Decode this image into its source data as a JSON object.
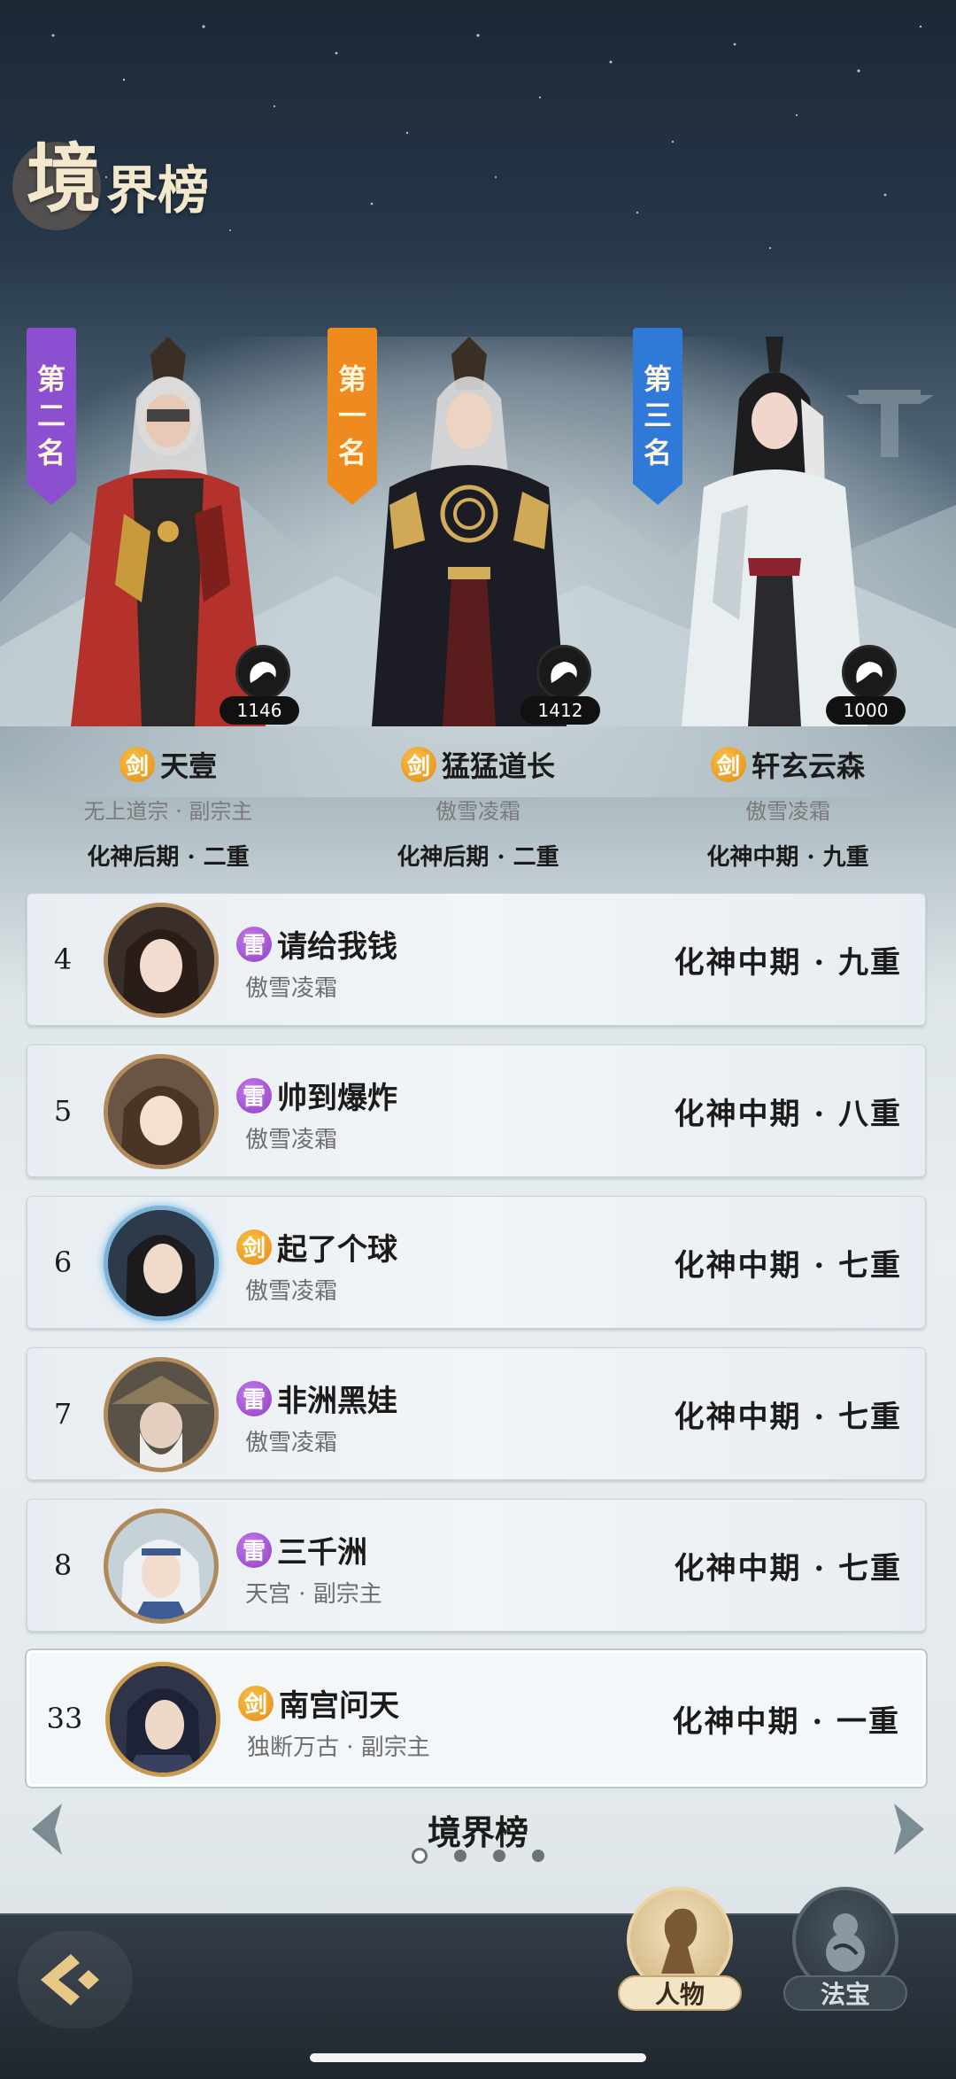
{
  "header": {
    "title_main": "境",
    "title_sub": "界榜"
  },
  "top3": [
    {
      "banner": [
        "第",
        "二",
        "名"
      ],
      "banner_color": "#8b4fd0",
      "power": "1146",
      "tag": "剑",
      "name": "天壹",
      "sect": "无上道宗 · 副宗主",
      "realm": "化神后期 · 二重"
    },
    {
      "banner": [
        "第",
        "一",
        "名"
      ],
      "banner_color": "#ee8a1e",
      "power": "1412",
      "tag": "剑",
      "name": "猛猛道长",
      "sect": "傲雪凌霜",
      "realm": "化神后期 · 二重"
    },
    {
      "banner": [
        "第",
        "三",
        "名"
      ],
      "banner_color": "#2f7ad8",
      "power": "1000",
      "tag": "剑",
      "name": "轩玄云森",
      "sect": "傲雪凌霜",
      "realm": "化神中期 · 九重"
    }
  ],
  "ranking": [
    {
      "rank": "4",
      "tag": "雷",
      "tag_type": "lei",
      "name": "请给我钱",
      "sect": "傲雪凌霜",
      "realm": "化神中期 · 九重"
    },
    {
      "rank": "5",
      "tag": "雷",
      "tag_type": "lei",
      "name": "帅到爆炸",
      "sect": "傲雪凌霜",
      "realm": "化神中期 · 八重"
    },
    {
      "rank": "6",
      "tag": "剑",
      "tag_type": "jian",
      "name": "起了个球",
      "sect": "傲雪凌霜",
      "realm": "化神中期 · 七重"
    },
    {
      "rank": "7",
      "tag": "雷",
      "tag_type": "lei",
      "name": "非洲黑娃",
      "sect": "傲雪凌霜",
      "realm": "化神中期 · 七重"
    },
    {
      "rank": "8",
      "tag": "雷",
      "tag_type": "lei",
      "name": "三千洲",
      "sect": "天宫 · 副宗主",
      "realm": "化神中期 · 七重"
    }
  ],
  "me": {
    "rank": "33",
    "tag": "剑",
    "tag_type": "jian",
    "name": "南宫问天",
    "sect": "独断万古 · 副宗主",
    "realm": "化神中期 · 一重"
  },
  "pager": {
    "title": "境界榜",
    "pages": 4,
    "active": 0
  },
  "nav": {
    "character": "人物",
    "treasure": "法宝"
  },
  "colors": {
    "gold": "#b08a5a",
    "jian": "#f0a22a",
    "lei": "#a254d6"
  }
}
